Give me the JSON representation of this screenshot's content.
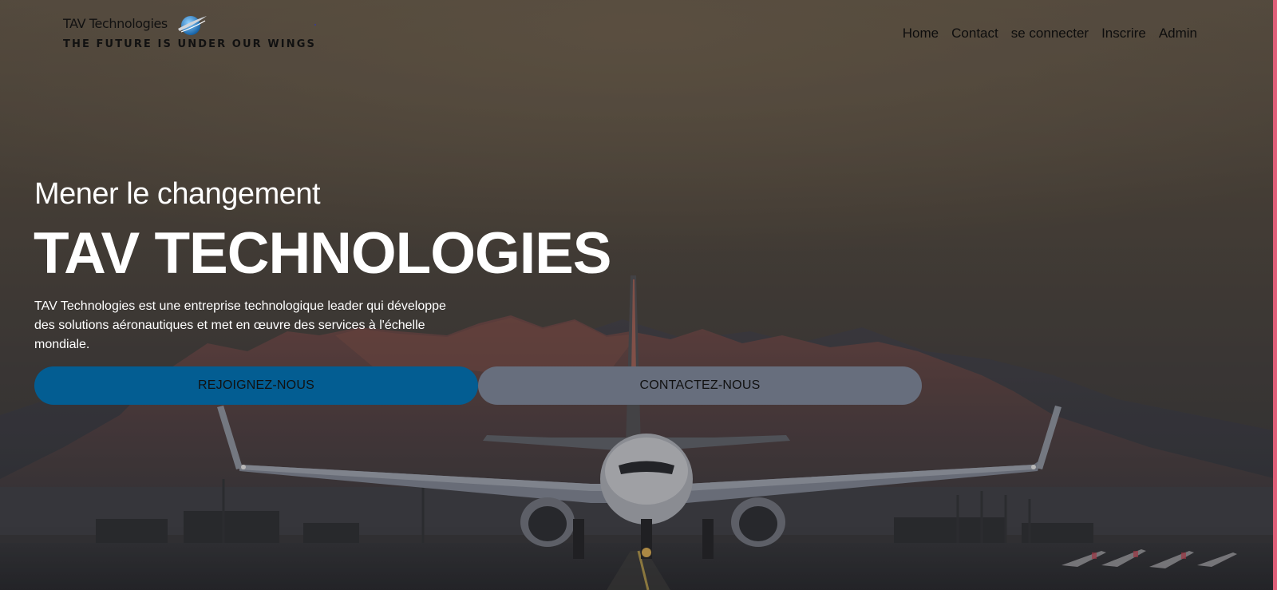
{
  "brand": {
    "name": "TAV Technologies",
    "tagline": "THE FUTURE IS UNDER OUR WINGS",
    "logo_icon": "globe-wing-icon"
  },
  "nav": {
    "items": [
      {
        "label": "Home"
      },
      {
        "label": "Contact"
      },
      {
        "label": "se connecter"
      },
      {
        "label": "Inscrire"
      },
      {
        "label": "Admin"
      }
    ]
  },
  "hero": {
    "subtitle": "Mener le changement",
    "title": "TAV TECHNOLOGIES",
    "description": "TAV Technologies est une entreprise technologique leader qui développe des solutions aéronautiques et met en œuvre des services à l'échelle mondiale.",
    "background_icon": "airplane-runway-mountains-photo",
    "buttons": {
      "primary": "REJOIGNEZ-NOUS",
      "secondary": "CONTACTEZ-NOUS"
    }
  },
  "colors": {
    "primary_button": "#035d92",
    "secondary_button": "#676e7d",
    "edge_accent": "#e0607a",
    "overlay": "#2e2c2b"
  }
}
